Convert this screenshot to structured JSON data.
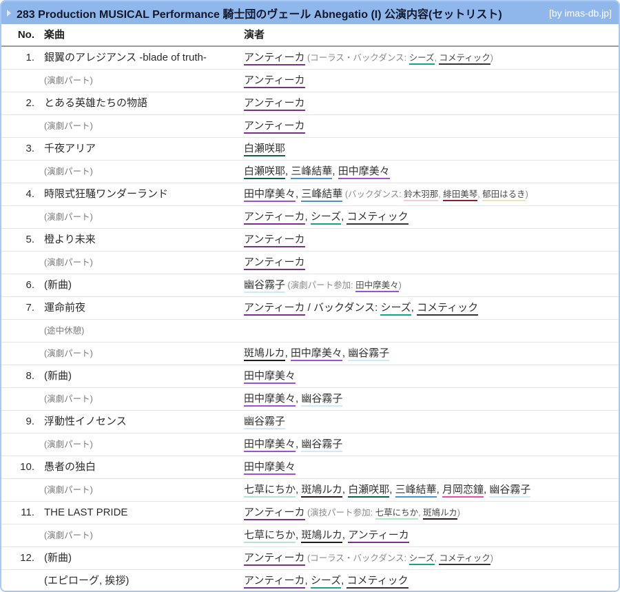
{
  "header": {
    "title": "283 Production MUSICAL Performance 騎士団のヴェール Abnegatio (I) 公演内容(セットリスト)",
    "credit": "[by imas-db.jp]"
  },
  "columns": {
    "no": "No.",
    "song": "楽曲",
    "performer": "演者"
  },
  "colors": {
    "header_bg": "#8fb7ec",
    "border": "#a9c9f3",
    "antica": "#7b2f8b",
    "shhis": "#13a384",
    "cometik": "#35313a",
    "mamimi": "#a04fd5",
    "yuika": "#4a8fce",
    "sakuya": "#0d5f46",
    "kiriko": "#cfe9f6",
    "kogane": "#ee4ba5",
    "nichika": "#b5e3cb",
    "luca": "#241a1d",
    "hana": "#f2cbd7",
    "mikoto": "#8c1f33",
    "haruki": "#ece5b6"
  },
  "rows": [
    {
      "no": "1.",
      "song": "銀翼のアレジアンス -blade of truth-",
      "song_style": "song",
      "performers": [
        {
          "type": "link",
          "text": "アンティーカ",
          "color": "antica"
        },
        {
          "type": "note",
          "text": " (コーラス・バックダンス: "
        },
        {
          "type": "notelink",
          "text": "シーズ",
          "color": "shhis"
        },
        {
          "type": "note",
          "text": ", "
        },
        {
          "type": "notelink",
          "text": "コメティック",
          "color": "cometik"
        },
        {
          "type": "note",
          "text": ")"
        }
      ]
    },
    {
      "no": "",
      "song": "(演劇パート)",
      "song_style": "note",
      "performers": [
        {
          "type": "link",
          "text": "アンティーカ",
          "color": "antica"
        }
      ]
    },
    {
      "no": "2.",
      "song": "とある英雄たちの物語",
      "song_style": "song",
      "performers": [
        {
          "type": "link",
          "text": "アンティーカ",
          "color": "antica"
        }
      ]
    },
    {
      "no": "",
      "song": "(演劇パート)",
      "song_style": "note",
      "performers": [
        {
          "type": "link",
          "text": "アンティーカ",
          "color": "antica"
        }
      ]
    },
    {
      "no": "3.",
      "song": "千夜アリア",
      "song_style": "song",
      "performers": [
        {
          "type": "link",
          "text": "白瀬咲耶",
          "color": "sakuya"
        }
      ]
    },
    {
      "no": "",
      "song": "(演劇パート)",
      "song_style": "note",
      "performers": [
        {
          "type": "link",
          "text": "白瀬咲耶",
          "color": "sakuya"
        },
        {
          "type": "text",
          "text": ", "
        },
        {
          "type": "link",
          "text": "三峰結華",
          "color": "yuika"
        },
        {
          "type": "text",
          "text": ", "
        },
        {
          "type": "link",
          "text": "田中摩美々",
          "color": "mamimi"
        }
      ]
    },
    {
      "no": "4.",
      "song": "時限式狂騒ワンダーランド",
      "song_style": "song",
      "performers": [
        {
          "type": "link",
          "text": "田中摩美々",
          "color": "mamimi"
        },
        {
          "type": "text",
          "text": ", "
        },
        {
          "type": "link",
          "text": "三峰結華",
          "color": "yuika"
        },
        {
          "type": "note",
          "text": " (バックダンス: "
        },
        {
          "type": "notelink",
          "text": "鈴木羽那",
          "color": "hana"
        },
        {
          "type": "note",
          "text": ", "
        },
        {
          "type": "notelink",
          "text": "緋田美琴",
          "color": "mikoto"
        },
        {
          "type": "note",
          "text": ", "
        },
        {
          "type": "notelink",
          "text": "郁田はるき",
          "color": "haruki"
        },
        {
          "type": "note",
          "text": ")"
        }
      ]
    },
    {
      "no": "",
      "song": "(演劇パート)",
      "song_style": "note",
      "performers": [
        {
          "type": "link",
          "text": "アンティーカ",
          "color": "antica"
        },
        {
          "type": "text",
          "text": ", "
        },
        {
          "type": "link",
          "text": "シーズ",
          "color": "shhis"
        },
        {
          "type": "text",
          "text": ", "
        },
        {
          "type": "link",
          "text": "コメティック",
          "color": "cometik"
        }
      ]
    },
    {
      "no": "5.",
      "song": "橙より未来",
      "song_style": "song",
      "performers": [
        {
          "type": "link",
          "text": "アンティーカ",
          "color": "antica"
        }
      ]
    },
    {
      "no": "",
      "song": "(演劇パート)",
      "song_style": "note",
      "performers": [
        {
          "type": "link",
          "text": "アンティーカ",
          "color": "antica"
        }
      ]
    },
    {
      "no": "6.",
      "song": "(新曲)",
      "song_style": "song",
      "performers": [
        {
          "type": "link",
          "text": "幽谷霧子",
          "color": "kiriko"
        },
        {
          "type": "note",
          "text": " (演劇パート参加: "
        },
        {
          "type": "notelink",
          "text": "田中摩美々",
          "color": "mamimi"
        },
        {
          "type": "note",
          "text": ")"
        }
      ]
    },
    {
      "no": "7.",
      "song": "運命前夜",
      "song_style": "song",
      "performers": [
        {
          "type": "link",
          "text": "アンティーカ",
          "color": "antica"
        },
        {
          "type": "text",
          "text": " / バックダンス: "
        },
        {
          "type": "link",
          "text": "シーズ",
          "color": "shhis"
        },
        {
          "type": "text",
          "text": ", "
        },
        {
          "type": "link",
          "text": "コメティック",
          "color": "cometik"
        }
      ]
    },
    {
      "no": "",
      "song": "(途中休憩)",
      "song_style": "note",
      "performers": []
    },
    {
      "no": "",
      "song": "(演劇パート)",
      "song_style": "note",
      "performers": [
        {
          "type": "link",
          "text": "斑鳩ルカ",
          "color": "luca"
        },
        {
          "type": "text",
          "text": ", "
        },
        {
          "type": "link",
          "text": "田中摩美々",
          "color": "mamimi"
        },
        {
          "type": "text",
          "text": ", "
        },
        {
          "type": "link",
          "text": "幽谷霧子",
          "color": "kiriko"
        }
      ]
    },
    {
      "no": "8.",
      "song": "(新曲)",
      "song_style": "song",
      "performers": [
        {
          "type": "link",
          "text": "田中摩美々",
          "color": "mamimi"
        }
      ]
    },
    {
      "no": "",
      "song": "(演劇パート)",
      "song_style": "note",
      "performers": [
        {
          "type": "link",
          "text": "田中摩美々",
          "color": "mamimi"
        },
        {
          "type": "text",
          "text": ", "
        },
        {
          "type": "link",
          "text": "幽谷霧子",
          "color": "kiriko"
        }
      ]
    },
    {
      "no": "9.",
      "song": "浮動性イノセンス",
      "song_style": "song",
      "performers": [
        {
          "type": "link",
          "text": "幽谷霧子",
          "color": "kiriko"
        }
      ]
    },
    {
      "no": "",
      "song": "(演劇パート)",
      "song_style": "note",
      "performers": [
        {
          "type": "link",
          "text": "田中摩美々",
          "color": "mamimi"
        },
        {
          "type": "text",
          "text": ", "
        },
        {
          "type": "link",
          "text": "幽谷霧子",
          "color": "kiriko"
        }
      ]
    },
    {
      "no": "10.",
      "song": "愚者の独白",
      "song_style": "song",
      "performers": [
        {
          "type": "link",
          "text": "田中摩美々",
          "color": "mamimi"
        }
      ]
    },
    {
      "no": "",
      "song": "(演劇パート)",
      "song_style": "note",
      "performers": [
        {
          "type": "link",
          "text": "七草にちか",
          "color": "nichika"
        },
        {
          "type": "text",
          "text": ", "
        },
        {
          "type": "link",
          "text": "斑鳩ルカ",
          "color": "luca"
        },
        {
          "type": "text",
          "text": ", "
        },
        {
          "type": "link",
          "text": "白瀬咲耶",
          "color": "sakuya"
        },
        {
          "type": "text",
          "text": ", "
        },
        {
          "type": "link",
          "text": "三峰結華",
          "color": "yuika"
        },
        {
          "type": "text",
          "text": ", "
        },
        {
          "type": "link",
          "text": "月岡恋鐘",
          "color": "kogane"
        },
        {
          "type": "text",
          "text": ", "
        },
        {
          "type": "link",
          "text": "幽谷霧子",
          "color": "kiriko"
        }
      ]
    },
    {
      "no": "11.",
      "song": "THE LAST PRIDE",
      "song_style": "song",
      "performers": [
        {
          "type": "link",
          "text": "アンティーカ",
          "color": "antica"
        },
        {
          "type": "note",
          "text": " (演技パート参加: "
        },
        {
          "type": "notelink",
          "text": "七草にちか",
          "color": "nichika"
        },
        {
          "type": "note",
          "text": ", "
        },
        {
          "type": "notelink",
          "text": "斑鳩ルカ",
          "color": "luca"
        },
        {
          "type": "note",
          "text": ")"
        }
      ]
    },
    {
      "no": "",
      "song": "(演劇パート)",
      "song_style": "note",
      "performers": [
        {
          "type": "link",
          "text": "七草にちか",
          "color": "nichika"
        },
        {
          "type": "text",
          "text": ", "
        },
        {
          "type": "link",
          "text": "斑鳩ルカ",
          "color": "luca"
        },
        {
          "type": "text",
          "text": ", "
        },
        {
          "type": "link",
          "text": "アンティーカ",
          "color": "antica"
        }
      ]
    },
    {
      "no": "12.",
      "song": "(新曲)",
      "song_style": "song",
      "performers": [
        {
          "type": "link",
          "text": "アンティーカ",
          "color": "antica"
        },
        {
          "type": "note",
          "text": " (コーラス・バックダンス: "
        },
        {
          "type": "notelink",
          "text": "シーズ",
          "color": "shhis"
        },
        {
          "type": "note",
          "text": ", "
        },
        {
          "type": "notelink",
          "text": "コメティック",
          "color": "cometik"
        },
        {
          "type": "note",
          "text": ")"
        }
      ]
    },
    {
      "no": "",
      "song": "(エピローグ, 挨拶)",
      "song_style": "song",
      "performers": [
        {
          "type": "link",
          "text": "アンティーカ",
          "color": "antica"
        },
        {
          "type": "text",
          "text": ", "
        },
        {
          "type": "link",
          "text": "シーズ",
          "color": "shhis"
        },
        {
          "type": "text",
          "text": ", "
        },
        {
          "type": "link",
          "text": "コメティック",
          "color": "cometik"
        }
      ]
    }
  ]
}
